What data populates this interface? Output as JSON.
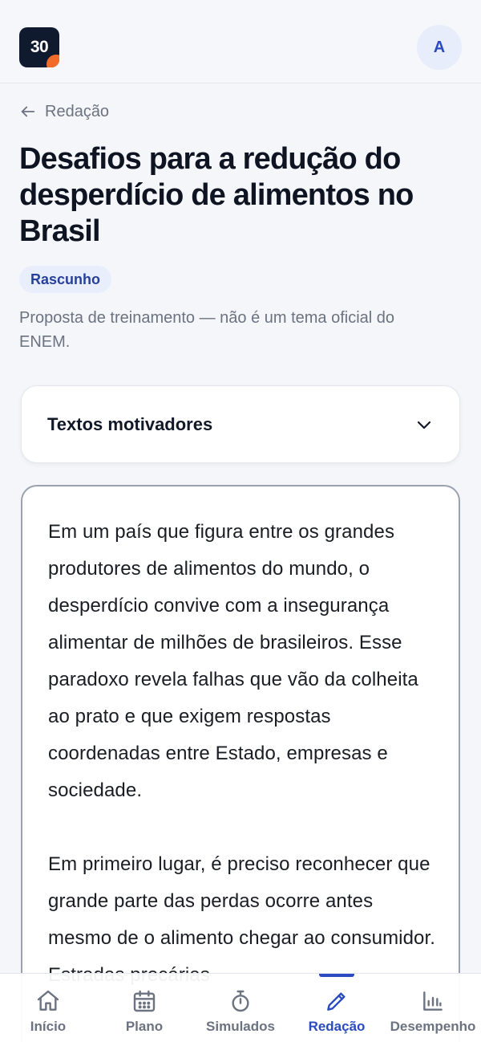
{
  "header": {
    "logo_text": "30",
    "avatar_initial": "A"
  },
  "back_link": {
    "label": "Redação"
  },
  "essay": {
    "title": "Desafios para a redução do desperdício de alimentos no Brasil",
    "status": "Rascunho",
    "disclaimer": "Proposta de treinamento — não é um tema oficial do ENEM.",
    "text": "Em um país que figura entre os grandes produtores de alimentos do mundo, o desperdício convive com a insegurança alimentar de milhões de brasileiros. Esse paradoxo revela falhas que vão da colheita ao prato e que exigem respostas coordenadas entre Estado, empresas e sociedade.\n\nEm primeiro lugar, é preciso reconhecer que grande parte das perdas ocorre antes mesmo de o alimento chegar ao consumidor. Estradas precárias"
  },
  "accordion": {
    "title": "Textos motivadores"
  },
  "nav": {
    "items": [
      {
        "label": "Início",
        "icon": "home-icon",
        "active": false
      },
      {
        "label": "Plano",
        "icon": "calendar-icon",
        "active": false
      },
      {
        "label": "Simulados",
        "icon": "stopwatch-icon",
        "active": false
      },
      {
        "label": "Redação",
        "icon": "pencil-icon",
        "active": true
      },
      {
        "label": "Desempenho",
        "icon": "bar-chart-icon",
        "active": false
      }
    ]
  },
  "colors": {
    "accent": "#2a4bc0",
    "logo_bg": "#0f1a2e",
    "logo_dot": "#f26b2a",
    "badge_bg": "#e9eefc"
  }
}
